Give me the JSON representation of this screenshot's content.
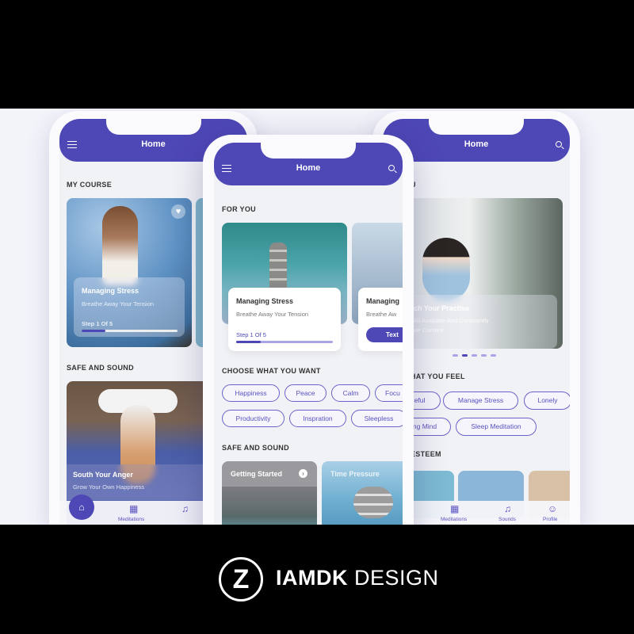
{
  "colors": {
    "accent": "#4e47b6",
    "chip_border": "#6b63c9",
    "background": "#f3f3fa"
  },
  "left_phone": {
    "header": {
      "title": "Home",
      "menu_icon": "hamburger-icon"
    },
    "my_course": {
      "title": "MY COURSE",
      "card": {
        "title": "Managing Stress",
        "subtitle": "Breathe Away Your Tension",
        "step": "Step 1 Of 5",
        "progress": 0.25,
        "favorite_icon": "heart-icon"
      }
    },
    "safe_and_sound": {
      "title": "SAFE AND SOUND",
      "card": {
        "title": "South Your Anger",
        "subtitle": "Grow Your Own Happiness"
      }
    },
    "nav": [
      {
        "icon": "home-icon",
        "label": ""
      },
      {
        "icon": "meditations-icon",
        "label": "Meditations"
      },
      {
        "icon": "music-note-icon",
        "label": ""
      }
    ]
  },
  "middle_phone": {
    "header": {
      "title": "Home"
    },
    "for_you": {
      "title": "FOR YOU",
      "cards": [
        {
          "title": "Managing Stress",
          "subtitle": "Breathe Away Your Tension",
          "step": "Step 1 Of 5",
          "progress": 0.25
        },
        {
          "title": "Managing",
          "subtitle": "Breathe Aw",
          "button": "Text"
        }
      ]
    },
    "choose": {
      "title": "CHOOSE WHAT YOU WANT",
      "chips": [
        "Happiness",
        "Peace",
        "Calm",
        "Focu",
        "Productivity",
        "Inspration",
        "Sleepless"
      ]
    },
    "safe_and_sound": {
      "title": "SAFE AND SOUND",
      "cards": [
        "Getting Started",
        "Time Pressure"
      ]
    }
  },
  "right_phone": {
    "header": {
      "title": "Home"
    },
    "for_you": {
      "title": "U",
      "card": {
        "title": "rich Your Practise",
        "subtitle_1": "h All Available And Constatntly",
        "subtitle_2": "date Content"
      },
      "carousel_active": 2,
      "carousel_count": 5
    },
    "feel": {
      "title": "HAT YOU FEEL",
      "chips": [
        "eful",
        "Manage Stress",
        "Lonely",
        "ng Mind",
        "Sleep Meditation"
      ]
    },
    "esteem": {
      "title": "ESTEEM"
    },
    "nav": [
      {
        "icon": "meditations-icon",
        "label": "Meditations"
      },
      {
        "icon": "music-note-icon",
        "label": "Sounds"
      },
      {
        "icon": "profile-icon",
        "label": "Profile"
      }
    ]
  },
  "brand": {
    "name_bold": "IAMDK",
    "name_light": "DESIGN",
    "logo": "Z"
  }
}
